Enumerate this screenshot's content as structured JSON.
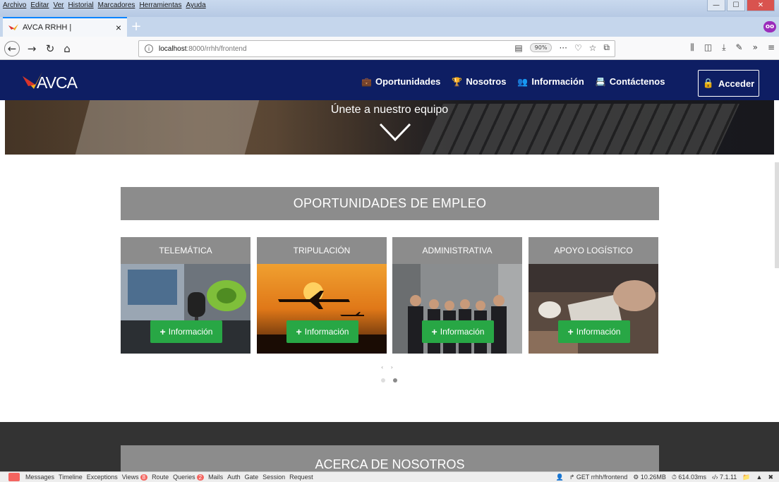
{
  "browser": {
    "menu": [
      "Archivo",
      "Editar",
      "Ver",
      "Historial",
      "Marcadores",
      "Herramientas",
      "Ayuda"
    ],
    "tab_title": "AVCA RRHH |",
    "url_host": "localhost",
    "url_path": ":8000/rrhh/frontend",
    "zoom": "90%"
  },
  "site": {
    "logo": "AVCA",
    "nav": [
      "Oportunidades",
      "Nosotros",
      "Información",
      "Contáctenos"
    ],
    "login": "Acceder"
  },
  "hero": {
    "title": "Únete a nuestro equipo"
  },
  "opportunities": {
    "title": "OPORTUNIDADES DE EMPLEO",
    "cards": [
      {
        "title": "TELEMÁTICA",
        "button": "Información"
      },
      {
        "title": "TRIPULACIÓN",
        "button": "Información"
      },
      {
        "title": "ADMINISTRATIVA",
        "button": "Información"
      },
      {
        "title": "APOYO LOGÍSTICO",
        "button": "Información"
      }
    ],
    "arrows": "‹ ›"
  },
  "about": {
    "title": "ACERCA DE NOSOTROS"
  },
  "debugbar": {
    "items": [
      "Messages",
      "Timeline",
      "Exceptions",
      "Views",
      "Route",
      "Queries",
      "Mails",
      "Auth",
      "Gate",
      "Session",
      "Request"
    ],
    "views_count": "8",
    "queries_count": "2",
    "request": "GET rrhh/frontend",
    "memory": "10.26MB",
    "time": "614.03ms",
    "version": "7.1.11"
  },
  "colors": {
    "navbar": "#0e1e63",
    "button_green": "#28a745",
    "section_gray": "#8c8c8c"
  }
}
